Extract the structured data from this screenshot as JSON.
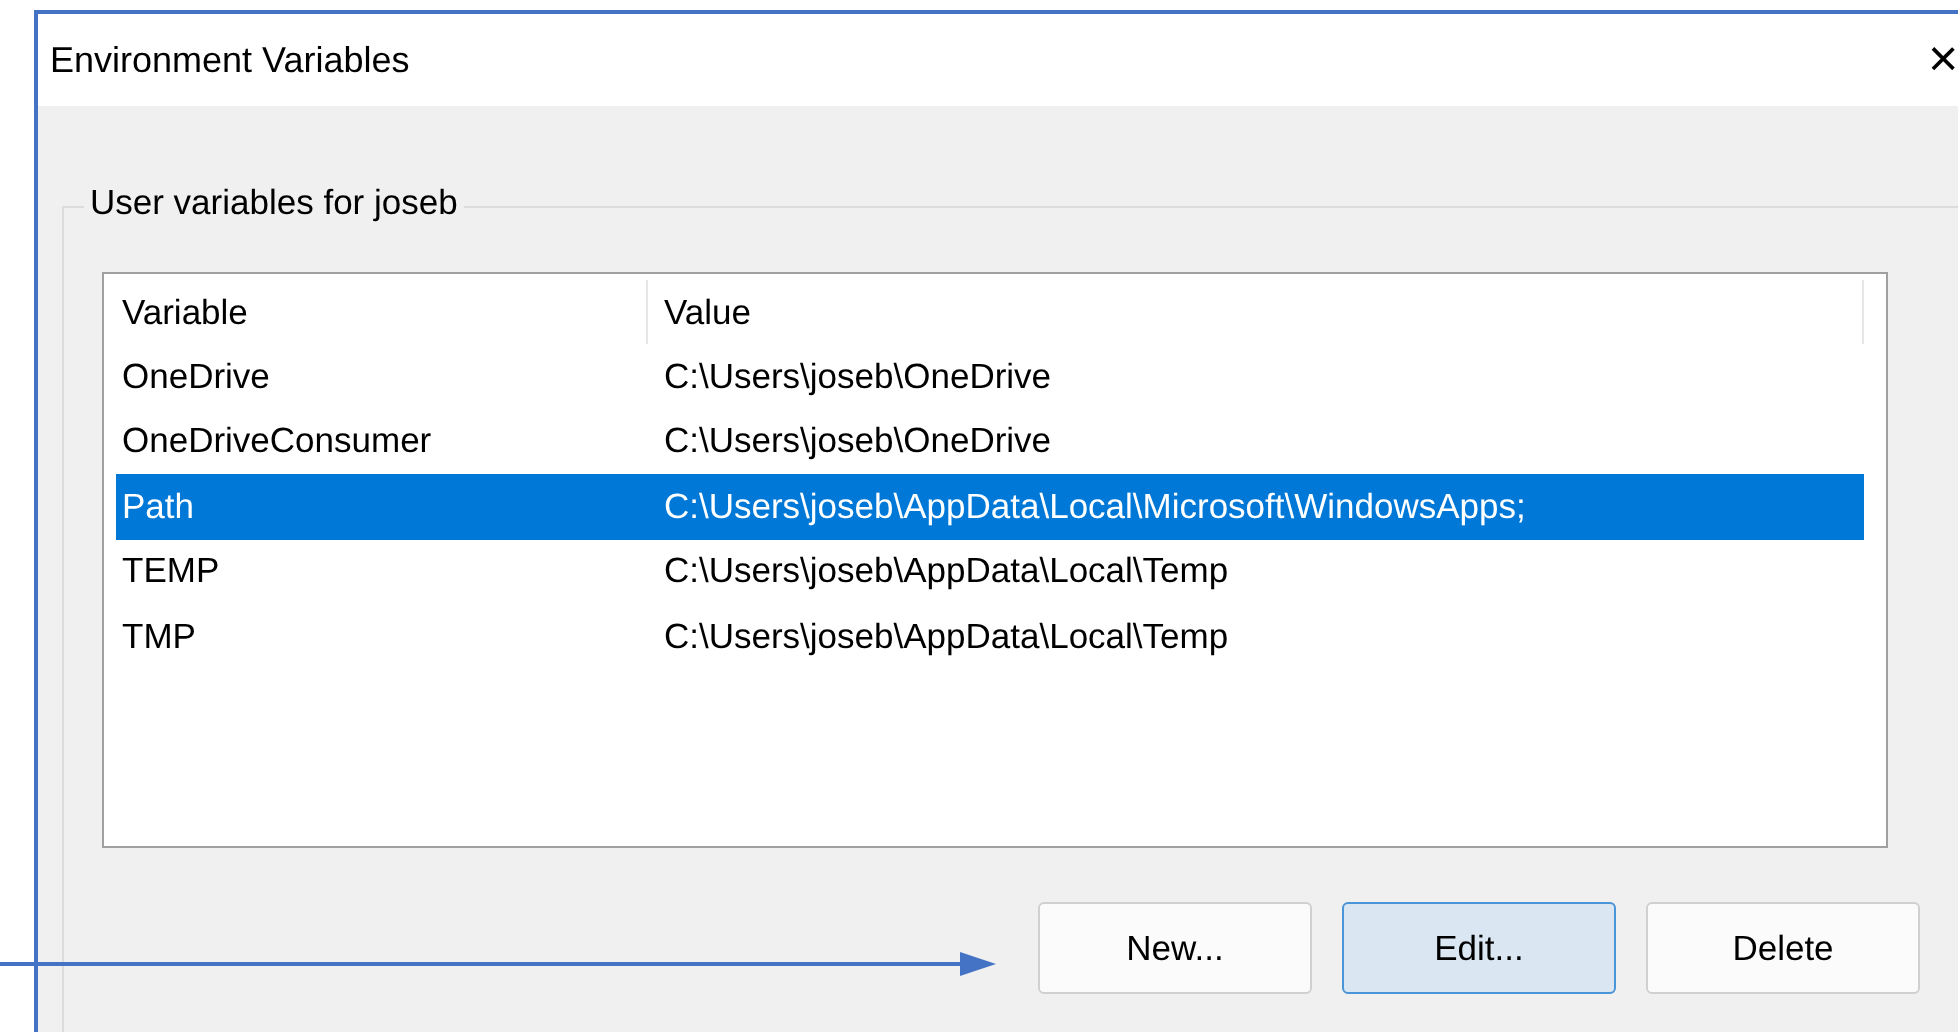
{
  "window": {
    "title": "Environment Variables",
    "close": "×"
  },
  "group": {
    "title": "User variables for joseb"
  },
  "table": {
    "columns": [
      "Variable",
      "Value"
    ],
    "rows": [
      {
        "variable": "OneDrive",
        "value": "C:\\Users\\joseb\\OneDrive",
        "selected": false
      },
      {
        "variable": "OneDriveConsumer",
        "value": "C:\\Users\\joseb\\OneDrive",
        "selected": false
      },
      {
        "variable": "Path",
        "value": "C:\\Users\\joseb\\AppData\\Local\\Microsoft\\WindowsApps;",
        "selected": true
      },
      {
        "variable": "TEMP",
        "value": "C:\\Users\\joseb\\AppData\\Local\\Temp",
        "selected": false
      },
      {
        "variable": "TMP",
        "value": "C:\\Users\\joseb\\AppData\\Local\\Temp",
        "selected": false
      }
    ]
  },
  "buttons": [
    {
      "label": "New...",
      "focused": false
    },
    {
      "label": "Edit...",
      "focused": true
    },
    {
      "label": "Delete",
      "focused": false
    }
  ]
}
